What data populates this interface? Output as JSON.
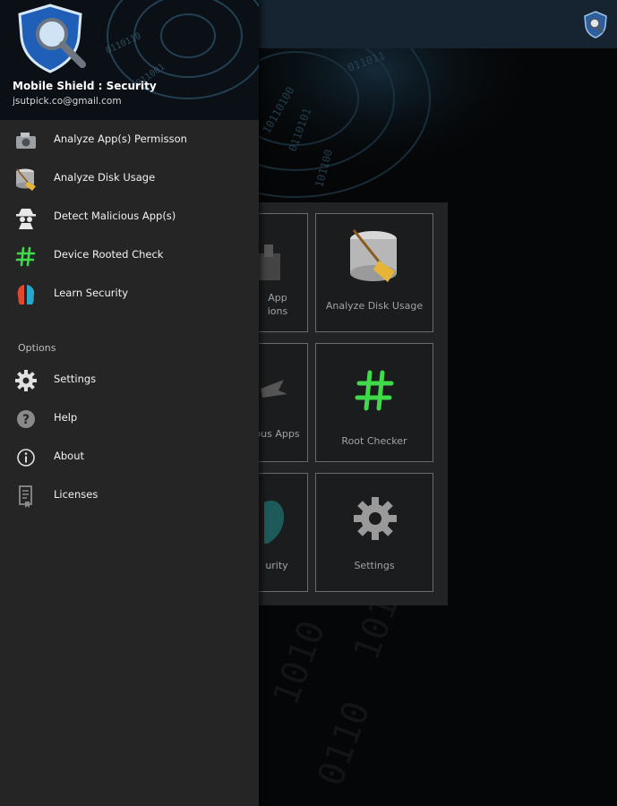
{
  "drawer": {
    "app_name": "Mobile Shield : Security",
    "email": "jsutpick.co@gmail.com",
    "main_items": [
      {
        "label": "Analyze App(s) Permisson",
        "icon": "camera-permission-icon"
      },
      {
        "label": "Analyze Disk Usage",
        "icon": "disk-broom-icon"
      },
      {
        "label": "Detect Malicious App(s)",
        "icon": "spy-icon"
      },
      {
        "label": "Device Rooted Check",
        "icon": "hash-icon"
      },
      {
        "label": "Learn Security",
        "icon": "head-icon"
      }
    ],
    "options_title": "Options",
    "option_items": [
      {
        "label": "Settings",
        "icon": "gear-icon"
      },
      {
        "label": "Help",
        "icon": "help-icon"
      },
      {
        "label": "About",
        "icon": "info-icon"
      },
      {
        "label": "Licenses",
        "icon": "license-icon"
      }
    ]
  },
  "grid": {
    "tiles": [
      {
        "label": "App\nions"
      },
      {
        "label": "Analyze Disk Usage"
      },
      {
        "label": "ious Apps"
      },
      {
        "label": "Root Checker"
      },
      {
        "label": "urity"
      },
      {
        "label": "Settings"
      }
    ]
  },
  "colors": {
    "drawer_bg": "#252525",
    "appbar_bg": "#152430",
    "text": "#f2f2f2"
  }
}
